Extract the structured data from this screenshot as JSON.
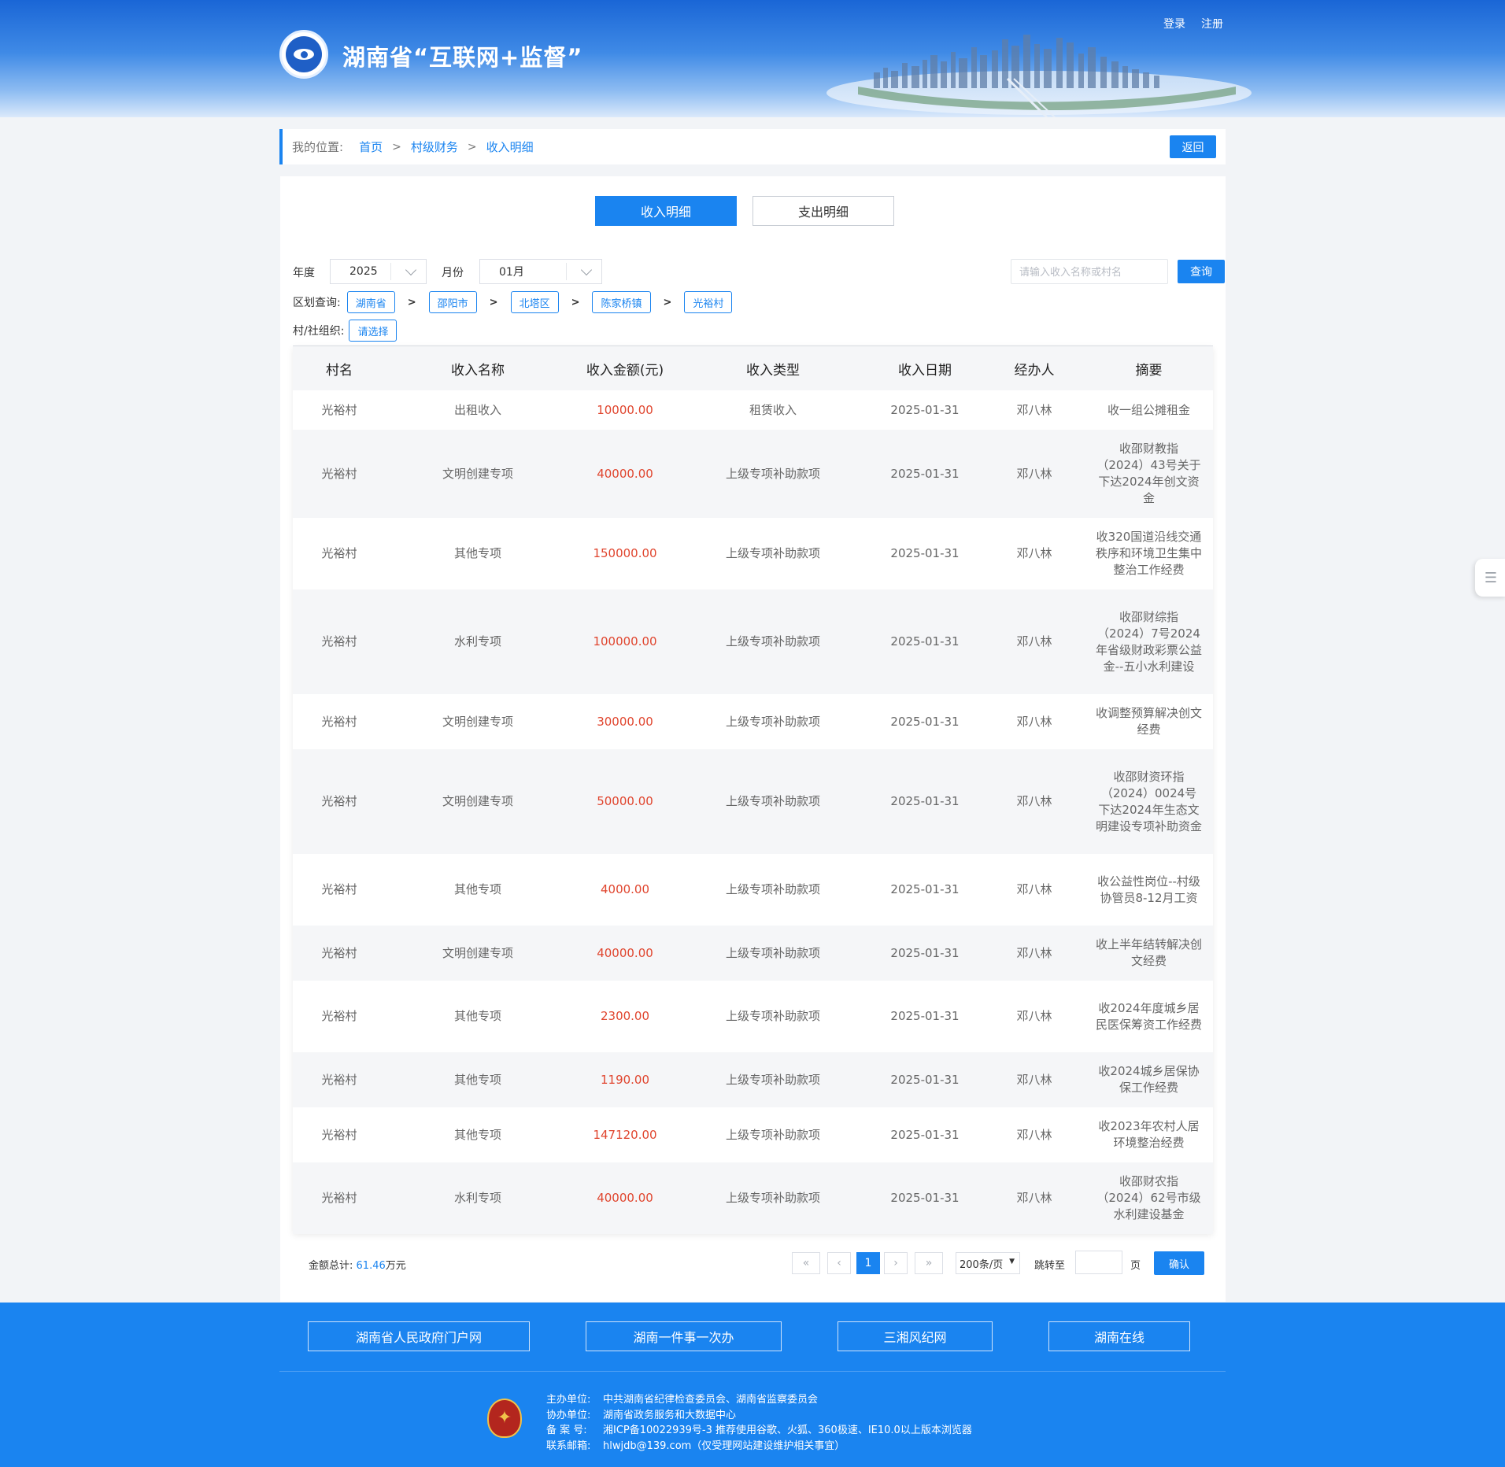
{
  "header": {
    "site_title": "湖南省“互联网+监督”",
    "login": "登录",
    "register": "注册"
  },
  "breadcrumb": {
    "label": "我的位置:",
    "items": [
      "首页",
      "村级财务",
      "收入明细"
    ],
    "separator": ">",
    "back_label": "返回"
  },
  "tabs": [
    {
      "label": "收入明细",
      "active": true
    },
    {
      "label": "支出明细",
      "active": false
    }
  ],
  "filters": {
    "year_label": "年度",
    "year_value": "2025",
    "month_label": "月份",
    "month_value": "01月",
    "search_placeholder": "请输入收入名称或村名",
    "query_label": "查询",
    "region_label": "区划查询:",
    "region_path": [
      "湖南省",
      "邵阳市",
      "北塔区",
      "陈家桥镇",
      "光裕村"
    ],
    "region_sep": ">",
    "org_label": "村/社组织:",
    "org_value": "请选择"
  },
  "table": {
    "columns": [
      "村名",
      "收入名称",
      "收入金额(元)",
      "收入类型",
      "收入日期",
      "经办人",
      "摘要"
    ],
    "rows": [
      [
        "光裕村",
        "出租收入",
        "10000.00",
        "租赁收入",
        "2025-01-31",
        "邓八林",
        "收一组公摊租金"
      ],
      [
        "光裕村",
        "文明创建专项",
        "40000.00",
        "上级专项补助款项",
        "2025-01-31",
        "邓八林",
        "收邵财教指（2024）43号关于下达2024年创文资金"
      ],
      [
        "光裕村",
        "其他专项",
        "150000.00",
        "上级专项补助款项",
        "2025-01-31",
        "邓八林",
        "收320国道沿线交通秩序和环境卫生集中整治工作经费"
      ],
      [
        "光裕村",
        "水利专项",
        "100000.00",
        "上级专项补助款项",
        "2025-01-31",
        "邓八林",
        "收邵财综指（2024）7号2024年省级财政彩票公益金--五小水利建设"
      ],
      [
        "光裕村",
        "文明创建专项",
        "30000.00",
        "上级专项补助款项",
        "2025-01-31",
        "邓八林",
        "收调整预算解决创文经费"
      ],
      [
        "光裕村",
        "文明创建专项",
        "50000.00",
        "上级专项补助款项",
        "2025-01-31",
        "邓八林",
        "收邵财资环指（2024）0024号下达2024年生态文明建设专项补助资金"
      ],
      [
        "光裕村",
        "其他专项",
        "4000.00",
        "上级专项补助款项",
        "2025-01-31",
        "邓八林",
        "收公益性岗位--村级协管员8-12月工资"
      ],
      [
        "光裕村",
        "文明创建专项",
        "40000.00",
        "上级专项补助款项",
        "2025-01-31",
        "邓八林",
        "收上半年结转解决创文经费"
      ],
      [
        "光裕村",
        "其他专项",
        "2300.00",
        "上级专项补助款项",
        "2025-01-31",
        "邓八林",
        "收2024年度城乡居民医保筹资工作经费"
      ],
      [
        "光裕村",
        "其他专项",
        "1190.00",
        "上级专项补助款项",
        "2025-01-31",
        "邓八林",
        "收2024城乡居保协保工作经费"
      ],
      [
        "光裕村",
        "其他专项",
        "147120.00",
        "上级专项补助款项",
        "2025-01-31",
        "邓八林",
        "收2023年农村人居环境整治经费"
      ],
      [
        "光裕村",
        "水利专项",
        "40000.00",
        "上级专项补助款项",
        "2025-01-31",
        "邓八林",
        "收邵财农指（2024）62号市级水利建设基金"
      ]
    ]
  },
  "pagination": {
    "total_label": "金额总计:",
    "total_value": "61.46",
    "total_unit": "万元",
    "first": "«",
    "prev": "‹",
    "current_page": "1",
    "next": "›",
    "last": "»",
    "page_size": "200条/页",
    "jump_label": "跳转至",
    "page_unit": "页",
    "confirm_label": "确认"
  },
  "footer": {
    "links": [
      "湖南省人民政府门户网",
      "湖南一件事一次办",
      "三湘风纪网",
      "湖南在线"
    ],
    "info": [
      {
        "key": "主办单位:",
        "value": "中共湖南省纪律检查委员会、湖南省监察委员会"
      },
      {
        "key": "协办单位:",
        "value": "湖南省政务服务和大数据中心"
      },
      {
        "key": "备  案  号:",
        "value": "湘ICP备10022939号-3   推荐使用谷歌、火狐、360极速、IE10.0以上版本浏览器"
      },
      {
        "key": "联系邮箱:",
        "value": "hlwjdb@139.com（仅受理网站建设维护相关事宜）"
      }
    ]
  },
  "colors": {
    "accent": "#1a84f0",
    "amount": "#e0452e",
    "footer_bg": "#1a84f0"
  },
  "icons": {
    "logo": "eye-emblem-icon",
    "side_tab": "list-menu-icon",
    "footer_emblem": "party-emblem-icon"
  }
}
